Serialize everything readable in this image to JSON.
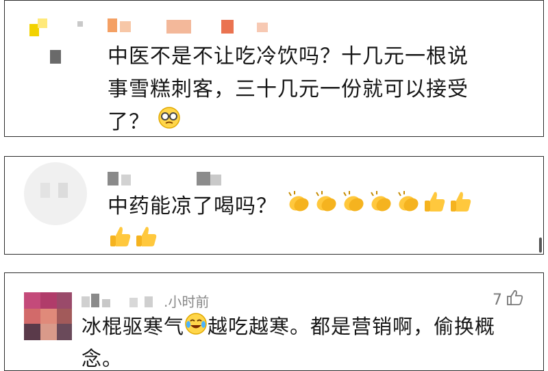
{
  "comments": [
    {
      "text_line1": "中医不是不让吃冷饮吗？十几元一根说",
      "text_line2": "事雪糕刺客，三十几元一份就可以接受",
      "text_line3": "了？",
      "emoji_icon": "speechless-glasses-emoji-icon"
    },
    {
      "text_line1": "中药能凉了喝吗？",
      "emoji_icons": [
        "clapping-hands-icon",
        "clapping-hands-icon",
        "clapping-hands-icon",
        "clapping-hands-icon",
        "clapping-hands-icon",
        "thumbs-up-icon",
        "thumbs-up-icon",
        "thumbs-up-icon",
        "thumbs-up-icon"
      ]
    },
    {
      "time": ".小时前",
      "likes": "7",
      "text_before_emoji": "冰棍驱寒气",
      "text_after_emoji": "越吃越寒。都是营销啊，偷换概",
      "text_line2": "念。",
      "emoji_icon": "laughing-crying-emoji-icon"
    }
  ]
}
